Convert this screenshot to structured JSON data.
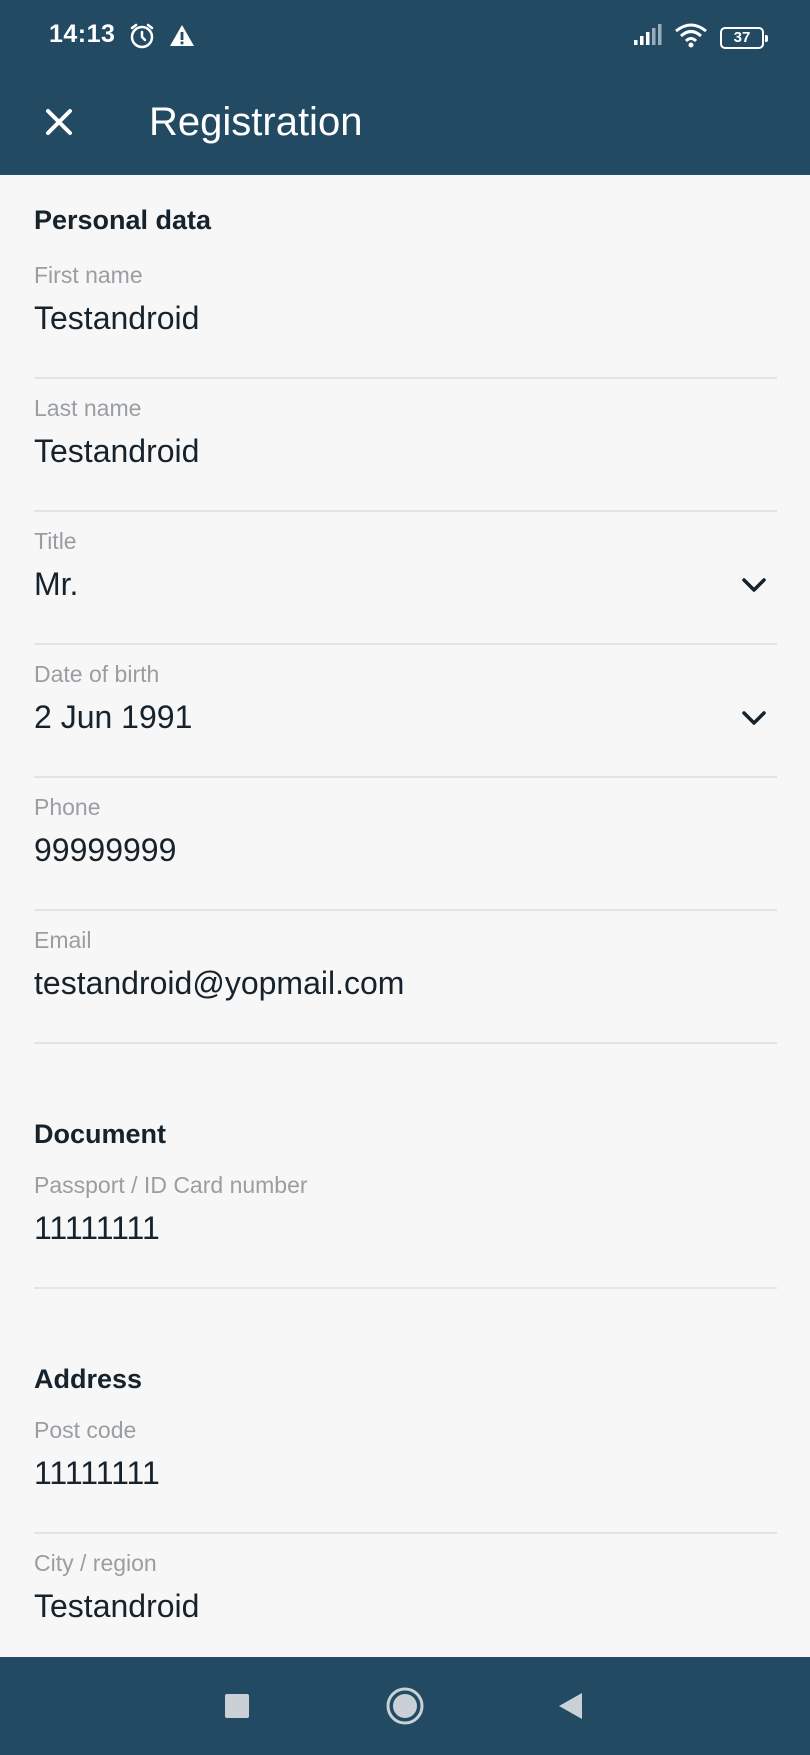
{
  "status_bar": {
    "time": "14:13",
    "icons": [
      "alarm-icon",
      "warning-icon",
      "signal-icon",
      "wifi-icon",
      "battery-icon"
    ],
    "battery_level": "37"
  },
  "app_bar": {
    "title": "Registration",
    "close_icon": "close-icon"
  },
  "sections": {
    "personal": {
      "title": "Personal data",
      "first_name": {
        "label": "First name",
        "value": "Testandroid"
      },
      "last_name": {
        "label": "Last name",
        "value": "Testandroid"
      },
      "title_field": {
        "label": "Title",
        "value": "Mr."
      },
      "dob": {
        "label": "Date of birth",
        "value": "2 Jun 1991"
      },
      "phone": {
        "label": "Phone",
        "value": "99999999"
      },
      "email": {
        "label": "Email",
        "value": "testandroid@yopmail.com"
      }
    },
    "document": {
      "title": "Document",
      "id_number": {
        "label": "Passport / ID Card number",
        "value": "11111111"
      }
    },
    "address": {
      "title": "Address",
      "post_code": {
        "label": "Post code",
        "value": "11111111"
      },
      "city": {
        "label": "City / region",
        "value": "Testandroid"
      }
    }
  },
  "nav_bar": {
    "icons": [
      "recents-icon",
      "home-icon",
      "back-icon"
    ]
  },
  "colors": {
    "primary": "#224a63",
    "background": "#f7f7f7",
    "label": "#9a9ea2",
    "text": "#16222c",
    "divider": "#e4e4e4"
  }
}
